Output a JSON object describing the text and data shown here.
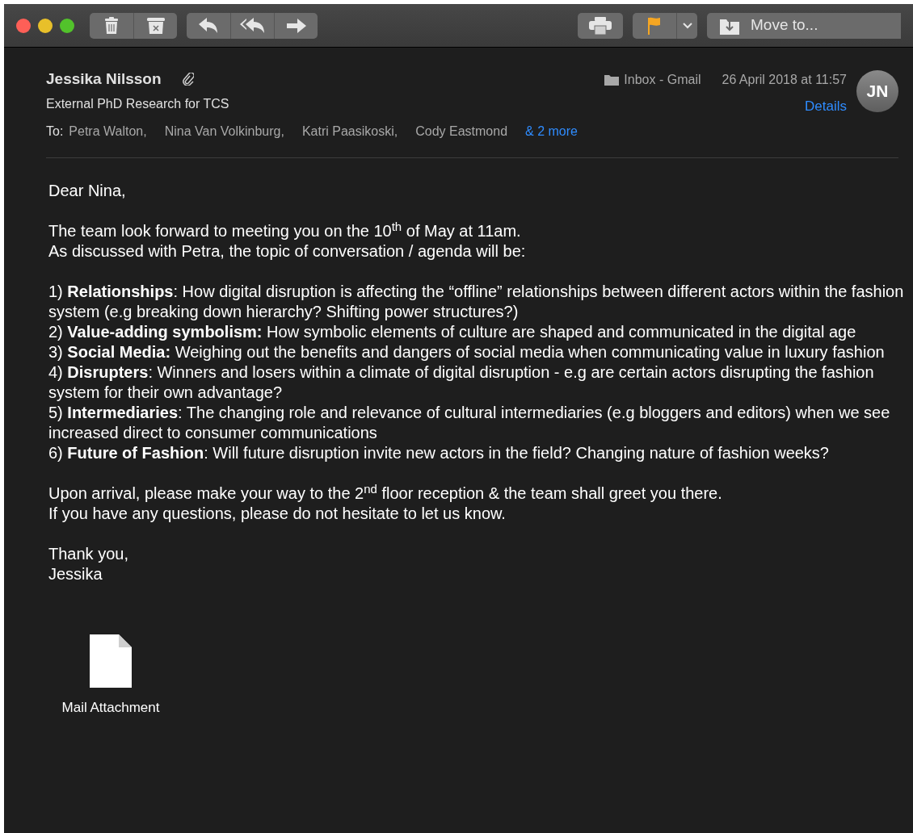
{
  "toolbar": {
    "buttons": [
      {
        "kind": "trash"
      },
      {
        "kind": "junk"
      },
      {
        "kind": "reply"
      },
      {
        "kind": "reply-all"
      },
      {
        "kind": "forward"
      },
      {
        "kind": "print"
      },
      {
        "kind": "flag"
      },
      {
        "kind": "chevron"
      }
    ],
    "move_to": "Move to..."
  },
  "header": {
    "sender": "Jessika Nilsson",
    "subject": "External PhD Research for TCS",
    "to_label": "To:",
    "recipients": [
      "Petra Walton,",
      "Nina Van Volkinburg,",
      "Katri Paasikoski,",
      "Cody Eastmond"
    ],
    "more": "& 2 more",
    "mailbox": "Inbox - Gmail",
    "date": "26 April 2018 at 11:57",
    "details": "Details",
    "avatar": "JN"
  },
  "body": [
    [
      "Dear Nina,"
    ],
    [
      "The team look forward to meeting you on the 10$^{th}$ of May at 11am.",
      "As discussed with Petra, the topic of conversation / agenda will be:"
    ],
    [
      "1) **Relationships**: How digital disruption is affecting the “offline” relationships between different actors within the fashion system (e.g breaking down hierarchy? Shifting power structures?)",
      "2) **Value-adding symbolism:** How symbolic elements of culture are shaped and communicated in the digital age",
      "3) **Social Media:** Weighing out the benefits and dangers of social media when communicating value in luxury fashion",
      "4) **Disrupters**: Winners and losers within a climate of digital disruption - e.g are certain actors disrupting the fashion system for their own advantage?",
      "5) **Intermediaries**: The changing role and relevance of cultural intermediaries (e.g bloggers and editors) when we see increased direct to consumer communications",
      "6) **Future of Fashion**: Will future disruption invite new actors in the field? Changing nature of fashion weeks?"
    ],
    [
      "Upon arrival, please make your way to the 2$^{nd}$ floor reception & the team shall greet you there.",
      "If you have any questions, please do not hesitate to let us know."
    ],
    [
      "Thank you,",
      "Jessika"
    ]
  ],
  "attachment": {
    "name": "Mail Attachment"
  }
}
